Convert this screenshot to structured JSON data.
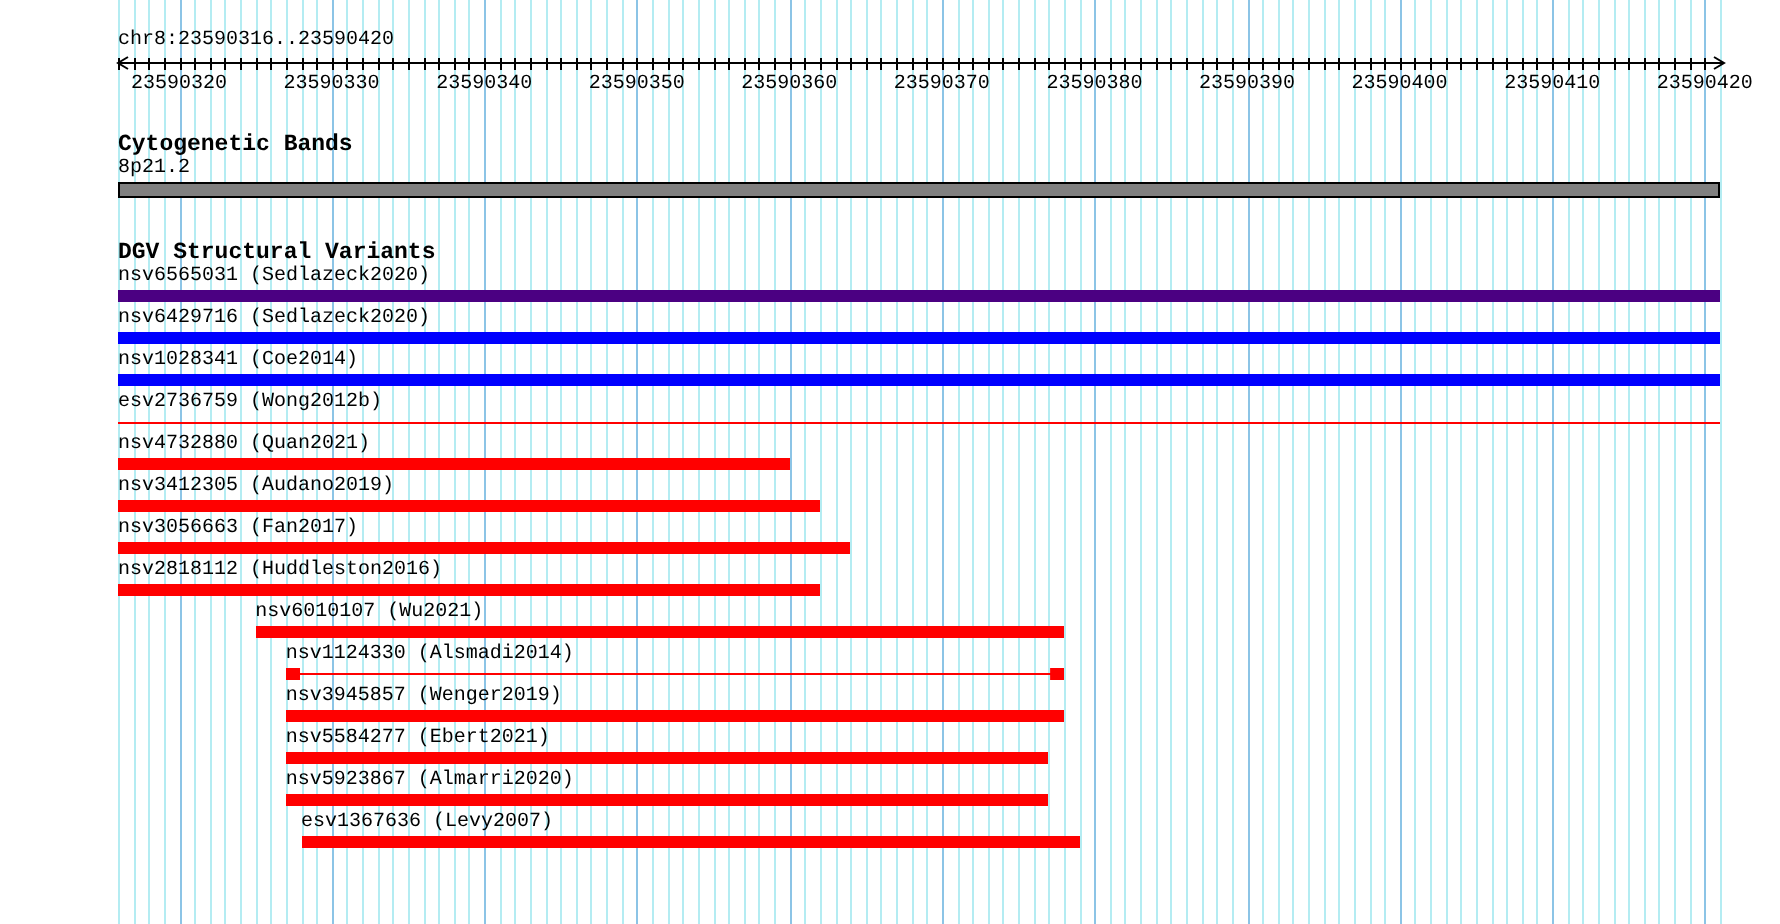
{
  "location": {
    "title": "chr8:23590316..23590420"
  },
  "ruler": {
    "labels": [
      "23590320",
      "23590330",
      "23590340",
      "23590350",
      "23590360",
      "23590370",
      "23590380",
      "23590390",
      "23590400",
      "23590410",
      "23590420"
    ]
  },
  "tracks": [
    {
      "kind": "bands",
      "title": "Cytogenetic Bands",
      "features": [
        {
          "label": "8p21.2",
          "color": "#808080"
        }
      ]
    },
    {
      "kind": "variants",
      "title": "DGV Structural Variants",
      "features": [
        {
          "label": "nsv6565031 (Sedlazeck2020)",
          "kind": "bar",
          "color": "#4b0082"
        },
        {
          "label": "nsv6429716 (Sedlazeck2020)",
          "kind": "bar",
          "color": "#0000ff"
        },
        {
          "label": "nsv1028341 (Coe2014)",
          "kind": "bar",
          "color": "#0000ff"
        },
        {
          "label": "esv2736759 (Wong2012b)",
          "kind": "line",
          "color": "#ff0000"
        },
        {
          "label": "nsv4732880 (Quan2021)",
          "kind": "bar",
          "color": "#ff0000"
        },
        {
          "label": "nsv3412305 (Audano2019)",
          "kind": "bar",
          "color": "#ff0000"
        },
        {
          "label": "nsv3056663 (Fan2017)",
          "kind": "bar",
          "color": "#ff0000"
        },
        {
          "label": "nsv2818112 (Huddleston2016)",
          "kind": "bar",
          "color": "#ff0000"
        },
        {
          "label": "nsv6010107 (Wu2021)",
          "kind": "bar",
          "color": "#ff0000"
        },
        {
          "label": "nsv1124330 (Alsmadi2014)",
          "kind": "split",
          "color": "#ff0000"
        },
        {
          "label": "nsv3945857 (Wenger2019)",
          "kind": "bar",
          "color": "#ff0000"
        },
        {
          "label": "nsv5584277 (Ebert2021)",
          "kind": "bar",
          "color": "#ff0000"
        },
        {
          "label": "nsv5923867 (Almarri2020)",
          "kind": "bar",
          "color": "#ff0000"
        },
        {
          "label": "esv1367636 (Levy2007)",
          "kind": "bar",
          "color": "#ff0000"
        }
      ]
    }
  ]
}
